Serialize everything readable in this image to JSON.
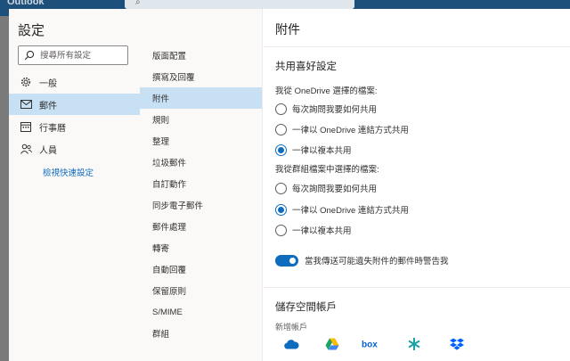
{
  "backdrop": {
    "app_title": "Outlook"
  },
  "sidebar": {
    "title": "設定",
    "search_placeholder": "搜尋所有設定",
    "items": [
      {
        "label": "一般",
        "icon": "gear-icon"
      },
      {
        "label": "郵件",
        "icon": "mail-icon",
        "active": true
      },
      {
        "label": "行事曆",
        "icon": "calendar-icon"
      },
      {
        "label": "人員",
        "icon": "people-icon"
      }
    ],
    "quick_settings_link": "檢視快速設定"
  },
  "mail_nav": {
    "items": [
      "版面配置",
      "撰寫及回覆",
      "附件",
      "規則",
      "整理",
      "垃圾郵件",
      "自訂動作",
      "同步電子郵件",
      "郵件處理",
      "轉寄",
      "自動回覆",
      "保留原則",
      "S/MIME",
      "群組"
    ],
    "active_index": 2
  },
  "panel": {
    "title": "附件",
    "shared_section_title": "共用喜好設定",
    "onedrive_group_label": "我從 OneDrive 選擇的檔案:",
    "onedrive_options": [
      "每次詢問我要如何共用",
      "一律以 OneDrive 連結方式共用",
      "一律以複本共用"
    ],
    "onedrive_selected": 2,
    "groups_group_label": "我從群組檔案中選擇的檔案:",
    "groups_options": [
      "每次詢問我要如何共用",
      "一律以 OneDrive 連結方式共用",
      "一律以複本共用"
    ],
    "groups_selected": 1,
    "warning_toggle_label": "當我傳送可能遺失附件的郵件時警告我",
    "warning_toggle_on": true,
    "storage_section_title": "儲存空間帳戶",
    "add_account_label": "新增帳戶",
    "providers": [
      "onedrive-icon",
      "google-drive-icon",
      "box-icon",
      "sharefile-icon",
      "dropbox-icon"
    ]
  },
  "colors": {
    "accent": "#0f6cbd",
    "selected_nav": "#c7e0f4"
  }
}
